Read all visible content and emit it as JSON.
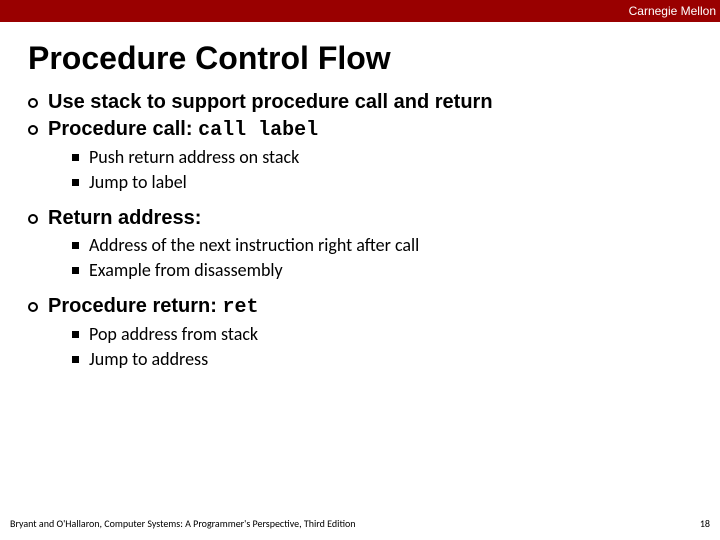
{
  "header": {
    "institution": "Carnegie Mellon"
  },
  "title": "Procedure Control Flow",
  "bullets": {
    "b1": "Use stack to support procedure call and return",
    "b2_prefix": "Procedure call: ",
    "b2_code": "call label",
    "b2_sub1": "Push return address on stack",
    "b2_sub2": "Jump to label",
    "b3": "Return address:",
    "b3_sub1": "Address of the next instruction right after call",
    "b3_sub2": "Example from disassembly",
    "b4_prefix": "Procedure return: ",
    "b4_code": "ret",
    "b4_sub1": "Pop address from stack",
    "b4_sub2": "Jump to address"
  },
  "footer": {
    "attribution": "Bryant and O'Hallaron, Computer Systems: A Programmer's Perspective, Third Edition",
    "page": "18"
  }
}
